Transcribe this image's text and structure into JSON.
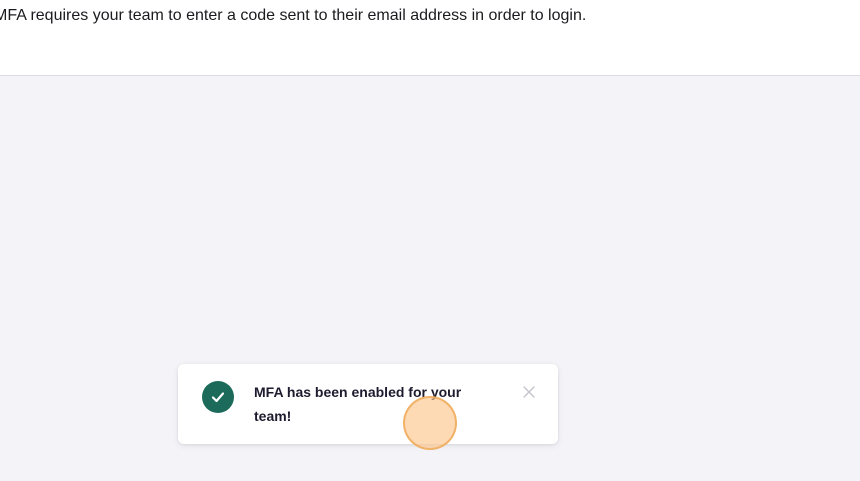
{
  "mfa_section": {
    "description": "MFA requires your team to enter a code sent to their email address in order to login."
  },
  "toast": {
    "message": "MFA has been enabled for your team!",
    "icon": "check-circle-icon",
    "close_icon": "close-icon",
    "accent_color": "#1c6b5a"
  },
  "colors": {
    "page_background": "#f4f4f8",
    "panel_background": "#ffffff",
    "click_indicator": "#fcc48c"
  }
}
